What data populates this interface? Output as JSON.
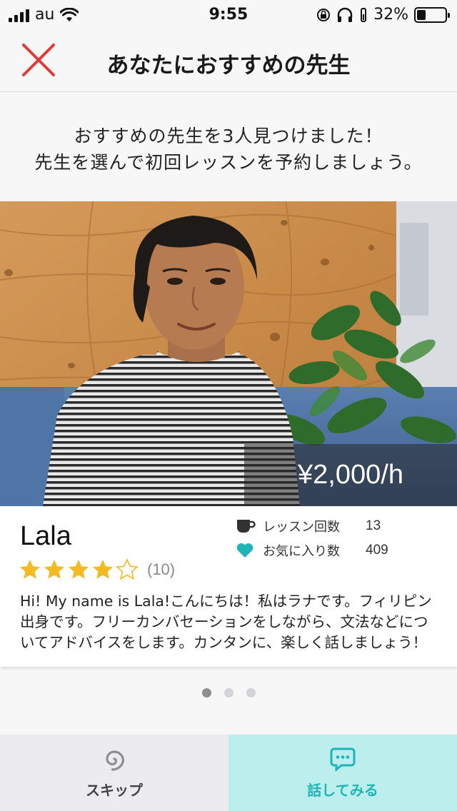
{
  "status_bar": {
    "carrier": "au",
    "time": "9:55",
    "battery": "32%",
    "battery_level": 0.32
  },
  "header": {
    "title": "あなたにおすすめの先生"
  },
  "intro": {
    "line1": "おすすめの先生を3人見つけました！",
    "line2": "先生を選んで初回レッスンを予約しましょう。"
  },
  "teacher": {
    "price": "¥2,000/h",
    "name": "Lala",
    "rating": 4,
    "rating_max": 5,
    "review_count": "(10)",
    "stats": [
      {
        "icon": "cup-icon",
        "label": "レッスン回数",
        "value": "13"
      },
      {
        "icon": "heart-icon",
        "label": "お気に入り数",
        "value": "409"
      }
    ],
    "bio": "Hi! My name is Lala!こんにちは！私はラナです。フィリピン出身です。フリーカンバセーションをしながら、文法などについてアドバイスをします。カンタンに、楽しく話しましょう！"
  },
  "pager": {
    "count": 3,
    "active": 1
  },
  "bottom_bar": {
    "skip_label": "スキップ",
    "talk_label": "話してみる"
  },
  "colors": {
    "accent_teal": "#1fb4b6",
    "talk_bg": "#bdeeee",
    "close_red": "#e53935",
    "star_yellow": "#f5b921"
  }
}
